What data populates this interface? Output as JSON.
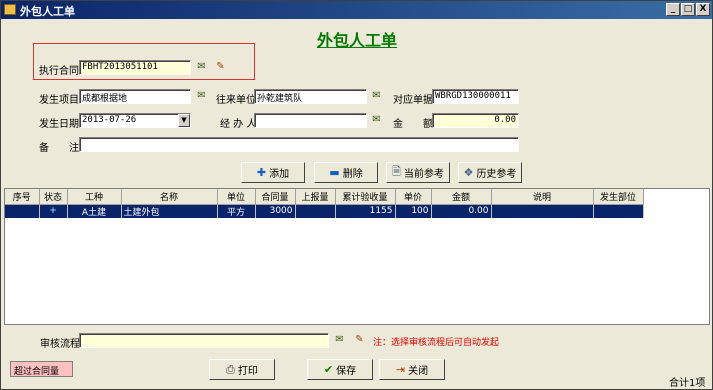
{
  "window": {
    "title": "外包人工单",
    "minimize": "_",
    "maximize": "□",
    "close": "X"
  },
  "form_title": "外包人工单",
  "contract": {
    "label": "执行合同",
    "value": "FBHT2013051101"
  },
  "fields": {
    "project": {
      "label": "发生项目",
      "value": "成都根据地"
    },
    "partner": {
      "label": "往来单位",
      "value": "孙乾建筑队"
    },
    "ref_doc": {
      "label": "对应单据",
      "value": "WBRGD130000011"
    },
    "date": {
      "label": "发生日期",
      "value": "2013-07-26"
    },
    "handler": {
      "label": "经 办 人",
      "value": ""
    },
    "amount": {
      "label": "金　　额",
      "value": "0.00"
    },
    "remark": {
      "label": "备　　注",
      "value": ""
    }
  },
  "buttons": {
    "add": "添加",
    "delete": "删除",
    "current_ref": "当前参考",
    "history_ref": "历史参考",
    "print": "打印",
    "save": "保存",
    "close": "关闭"
  },
  "grid": {
    "columns": [
      "序号",
      "状态",
      "工种",
      "名称",
      "单位",
      "合同量",
      "上报量",
      "累计验收量",
      "单价",
      "金额",
      "说明",
      "发生部位"
    ],
    "rows": [
      {
        "seq": "",
        "status": "+",
        "trade": "A土建",
        "name": "土建外包",
        "unit": "平方",
        "contract_qty": "3000",
        "reported_qty": "",
        "accepted_qty": "1155",
        "price": "100",
        "amount": "0.00",
        "desc": "",
        "location": ""
      }
    ]
  },
  "workflow": {
    "label": "审核流程",
    "value": "",
    "note": "注：选择审核流程后可自动发起"
  },
  "status": {
    "exceed_label": "超过合同量",
    "total": "合计1项"
  },
  "colors": {
    "title_green": "#007a00",
    "selection": "#0a246a",
    "warning_red": "#e00000",
    "exceed_bg": "#ffc0c0"
  }
}
